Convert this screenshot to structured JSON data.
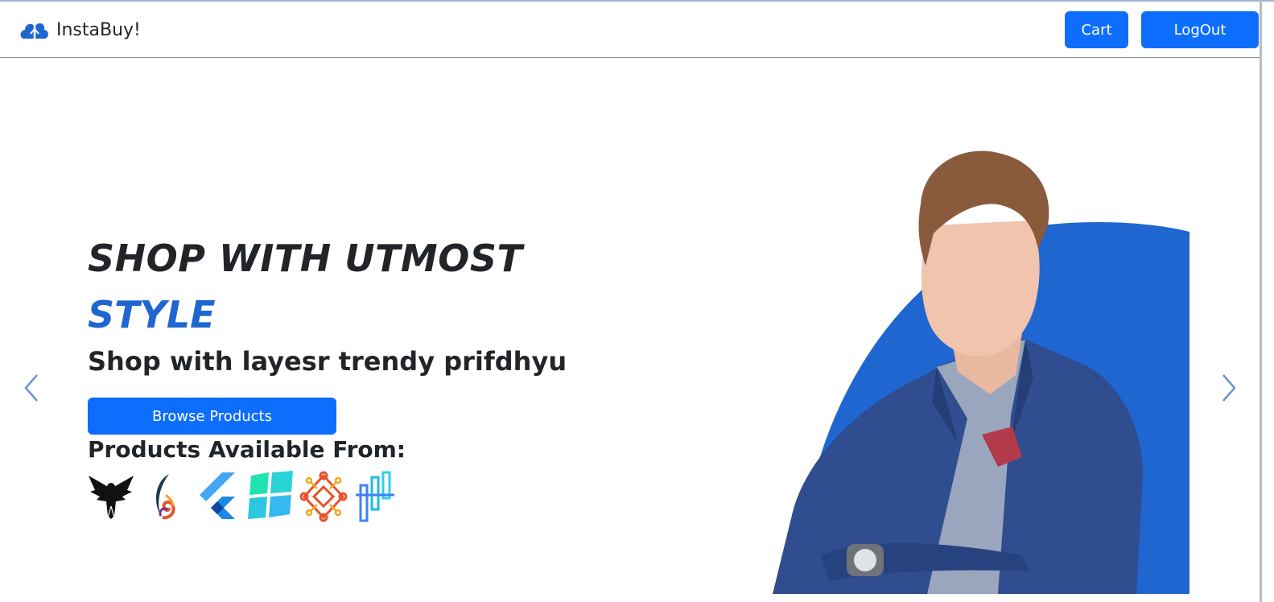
{
  "navbar": {
    "brand_name": "InstaBuy!",
    "brand_icon": "cloud-icon",
    "cart_label": "Cart",
    "logout_label": "LogOut"
  },
  "hero": {
    "title": "SHOP WITH UTMOST",
    "title_accent": "STYLE",
    "subtitle": "Shop with layesr trendy prifdhyu",
    "cta_label": "Browse Products",
    "brands_heading": "Products Available From:",
    "brand_logos": [
      "eagle-logo",
      "phoenix-logo",
      "flutter-logo",
      "windows-logo",
      "mandala-logo",
      "bars-logo"
    ],
    "image": "man-in-blue-suit-photo"
  },
  "carousel": {
    "prev_icon": "chevron-left-icon",
    "next_icon": "chevron-right-icon"
  },
  "colors": {
    "primary": "#0d6efd",
    "accent": "#1f66d1",
    "text": "#212529"
  }
}
